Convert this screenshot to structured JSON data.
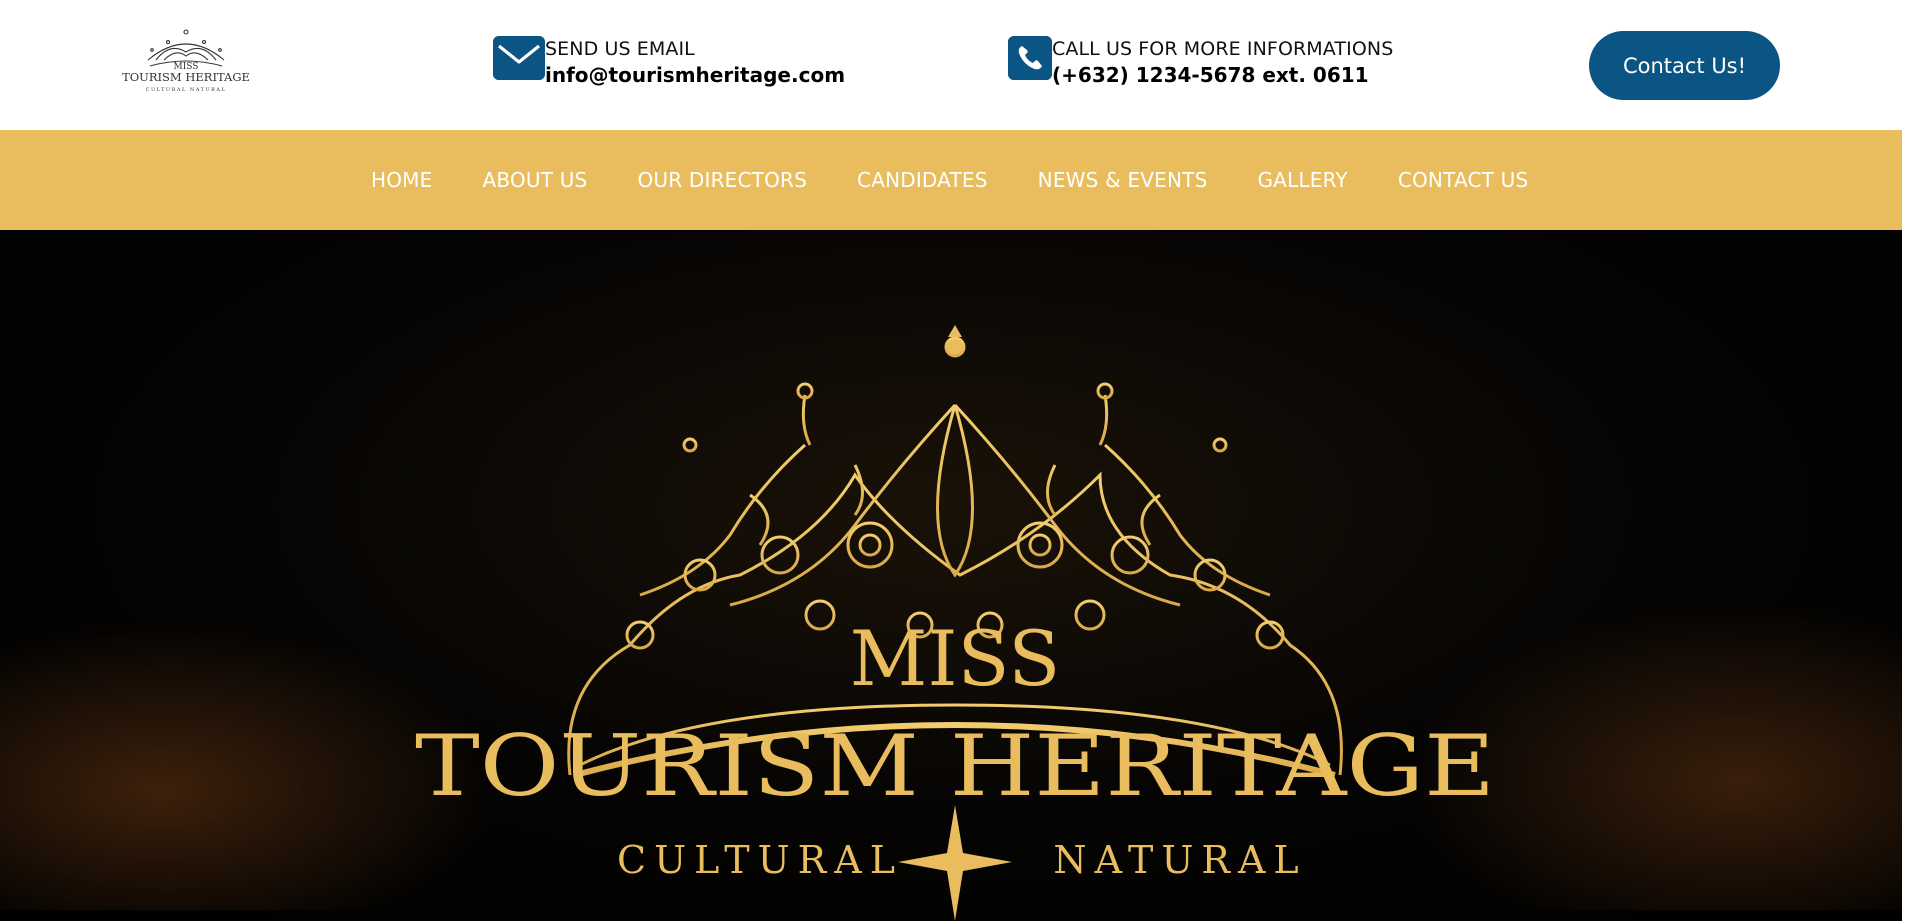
{
  "header": {
    "logo": {
      "text_line1": "MISS",
      "text_line2": "TOURISM HERITAGE",
      "text_line3": "CULTURAL NATURAL"
    },
    "email": {
      "icon": "envelope-icon",
      "label": "SEND US EMAIL",
      "value": "info@tourismheritage.com"
    },
    "phone": {
      "icon": "phone-icon",
      "label": "CALL US FOR MORE INFORMATIONS",
      "value": "(+632) 1234-5678 ext. 0611"
    },
    "contact_button": "Contact Us!"
  },
  "nav": {
    "items": [
      "HOME",
      "ABOUT US",
      "OUR DIRECTORS",
      "CANDIDATES",
      "NEWS & EVENTS",
      "GALLERY",
      "CONTACT US"
    ]
  },
  "hero": {
    "logo_line1": "MISS",
    "logo_line2": "TOURISM HERITAGE",
    "logo_left": "CULTURAL",
    "logo_right": "NATURAL"
  },
  "colors": {
    "brand_blue": "#0b5584",
    "gold": "#e9bd5e",
    "hero_bg": "#000000"
  }
}
